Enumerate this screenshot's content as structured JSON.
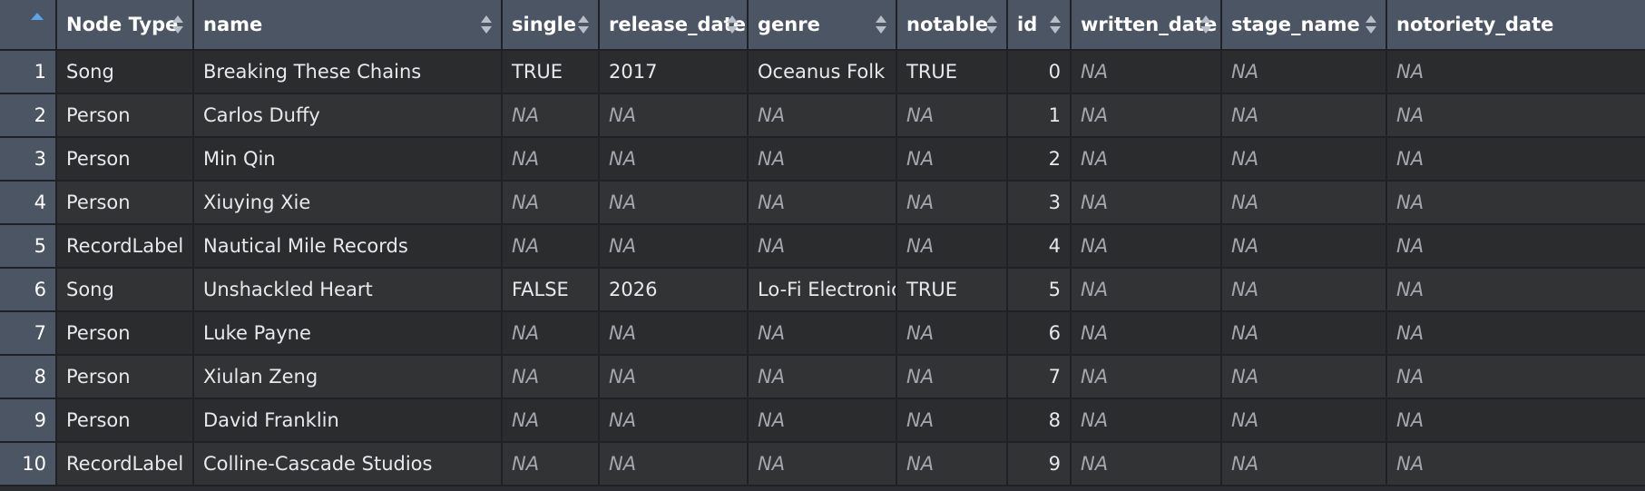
{
  "table": {
    "columns": [
      {
        "label": "Node Type"
      },
      {
        "label": "name"
      },
      {
        "label": "single"
      },
      {
        "label": "release_date"
      },
      {
        "label": "genre"
      },
      {
        "label": "notable"
      },
      {
        "label": "id"
      },
      {
        "label": "written_date"
      },
      {
        "label": "stage_name"
      },
      {
        "label": "notoriety_date"
      }
    ],
    "rows": [
      {
        "n": "1",
        "node_type": "Song",
        "name": "Breaking These Chains",
        "single": "TRUE",
        "release_date": "2017",
        "genre": "Oceanus Folk",
        "notable": "TRUE",
        "id": "0",
        "written_date": "NA",
        "stage_name": "NA",
        "notoriety_date": "NA"
      },
      {
        "n": "2",
        "node_type": "Person",
        "name": "Carlos Duffy",
        "single": "NA",
        "release_date": "NA",
        "genre": "NA",
        "notable": "NA",
        "id": "1",
        "written_date": "NA",
        "stage_name": "NA",
        "notoriety_date": "NA"
      },
      {
        "n": "3",
        "node_type": "Person",
        "name": "Min Qin",
        "single": "NA",
        "release_date": "NA",
        "genre": "NA",
        "notable": "NA",
        "id": "2",
        "written_date": "NA",
        "stage_name": "NA",
        "notoriety_date": "NA"
      },
      {
        "n": "4",
        "node_type": "Person",
        "name": "Xiuying Xie",
        "single": "NA",
        "release_date": "NA",
        "genre": "NA",
        "notable": "NA",
        "id": "3",
        "written_date": "NA",
        "stage_name": "NA",
        "notoriety_date": "NA"
      },
      {
        "n": "5",
        "node_type": "RecordLabel",
        "name": "Nautical Mile Records",
        "single": "NA",
        "release_date": "NA",
        "genre": "NA",
        "notable": "NA",
        "id": "4",
        "written_date": "NA",
        "stage_name": "NA",
        "notoriety_date": "NA"
      },
      {
        "n": "6",
        "node_type": "Song",
        "name": "Unshackled Heart",
        "single": "FALSE",
        "release_date": "2026",
        "genre": "Lo-Fi Electronica",
        "notable": "TRUE",
        "id": "5",
        "written_date": "NA",
        "stage_name": "NA",
        "notoriety_date": "NA"
      },
      {
        "n": "7",
        "node_type": "Person",
        "name": "Luke Payne",
        "single": "NA",
        "release_date": "NA",
        "genre": "NA",
        "notable": "NA",
        "id": "6",
        "written_date": "NA",
        "stage_name": "NA",
        "notoriety_date": "NA"
      },
      {
        "n": "8",
        "node_type": "Person",
        "name": "Xiulan Zeng",
        "single": "NA",
        "release_date": "NA",
        "genre": "NA",
        "notable": "NA",
        "id": "7",
        "written_date": "NA",
        "stage_name": "NA",
        "notoriety_date": "NA"
      },
      {
        "n": "9",
        "node_type": "Person",
        "name": "David Franklin",
        "single": "NA",
        "release_date": "NA",
        "genre": "NA",
        "notable": "NA",
        "id": "8",
        "written_date": "NA",
        "stage_name": "NA",
        "notoriety_date": "NA"
      },
      {
        "n": "10",
        "node_type": "RecordLabel",
        "name": "Colline-Cascade Studios",
        "single": "NA",
        "release_date": "NA",
        "genre": "NA",
        "notable": "NA",
        "id": "9",
        "written_date": "NA",
        "stage_name": "NA",
        "notoriety_date": "NA"
      }
    ]
  },
  "icons": {
    "sort_indicator": "sort-arrows-icon",
    "active_sort": "sort-ascending-icon"
  },
  "colors": {
    "header_bg": "#4b5563",
    "cell_bg": "#2b2c2e",
    "cell_alt_bg": "#323334",
    "na_text": "#a3a7ad",
    "sort_accent": "#58a6e6"
  }
}
